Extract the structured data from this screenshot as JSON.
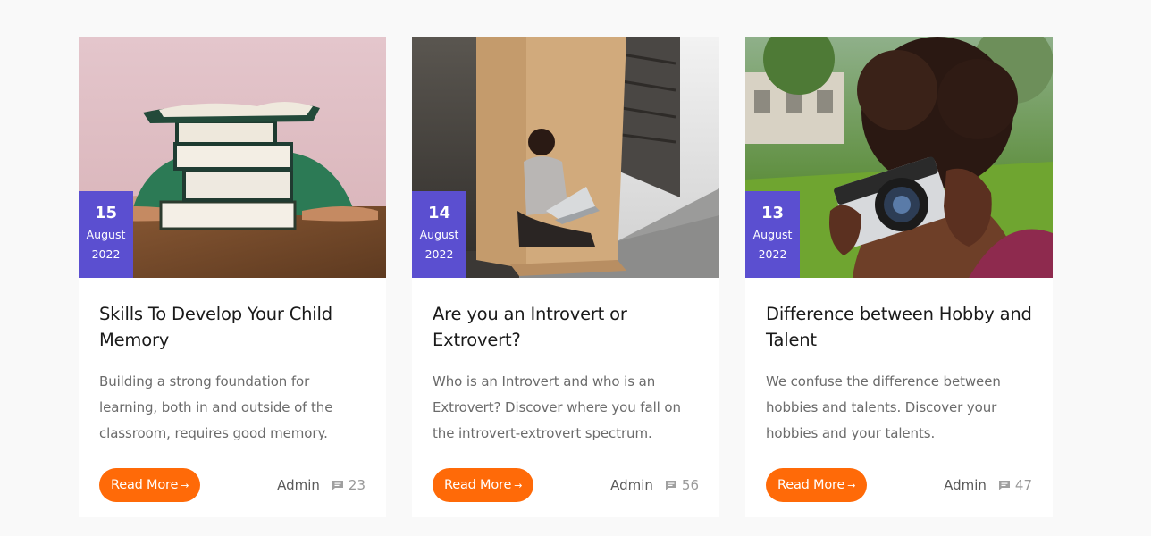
{
  "posts": [
    {
      "day": "15",
      "month": "August",
      "year": "2022",
      "title": "Skills To Develop Your Child Memory",
      "excerpt": "Building a strong foundation for learning, both in and outside of the classroom, requires good memory.",
      "read_more": "Read More",
      "author": "Admin",
      "comments": "23",
      "image": "books-stack-photo"
    },
    {
      "day": "14",
      "month": "August",
      "year": "2022",
      "title": "Are you an Introvert or Extrovert?",
      "excerpt": "Who is an Introvert and who is an Extrovert? Discover where you fall on the introvert-extrovert spectrum.",
      "read_more": "Read More",
      "author": "Admin",
      "comments": "56",
      "image": "woman-laptop-box-photo"
    },
    {
      "day": "13",
      "month": "August",
      "year": "2022",
      "title": "Difference between Hobby and Talent",
      "excerpt": "We confuse the difference between hobbies and talents. Discover your hobbies and your talents.",
      "read_more": "Read More",
      "author": "Admin",
      "comments": "47",
      "image": "camera-photographer-photo"
    }
  ],
  "colors": {
    "date_badge": "#5b4fd0",
    "button": "#ff6a08",
    "background": "#f9f9f9"
  }
}
